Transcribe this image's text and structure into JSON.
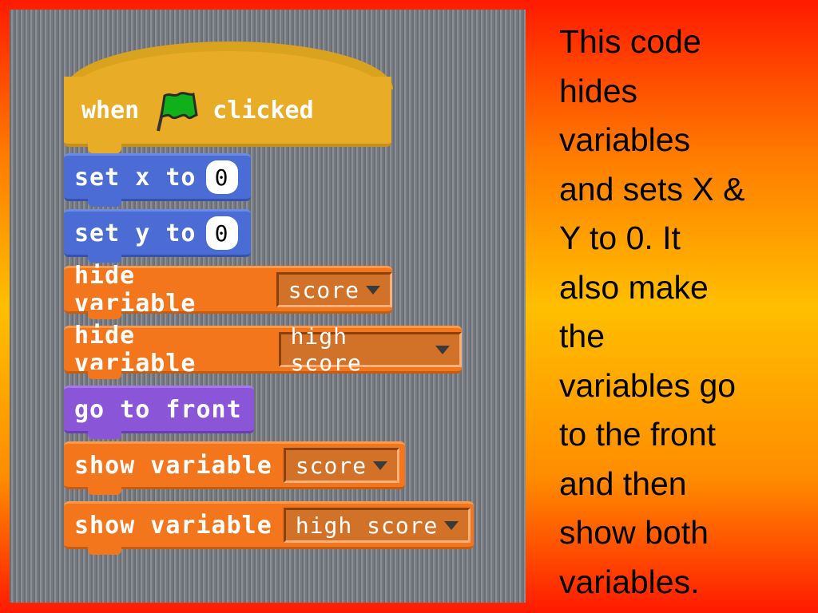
{
  "script": {
    "hat": {
      "before": "when",
      "flag_icon": "green-flag-icon",
      "after": "clicked"
    },
    "blocks": [
      {
        "category": "motion",
        "label": "set x to",
        "input": "0"
      },
      {
        "category": "motion",
        "label": "set y to",
        "input": "0"
      },
      {
        "category": "variables",
        "label": "hide variable",
        "dropdown": "score"
      },
      {
        "category": "variables",
        "label": "hide variable",
        "dropdown": "high score"
      },
      {
        "category": "looks",
        "label": "go to front"
      },
      {
        "category": "variables",
        "label": "show variable",
        "dropdown": "score"
      },
      {
        "category": "variables",
        "label": "show variable",
        "dropdown": "high score"
      }
    ]
  },
  "description": {
    "lines": [
      "This code",
      "hides",
      "variables",
      "and sets X &",
      "Y to 0. It",
      "also make",
      "the",
      "variables go",
      "to the front",
      "and then",
      "show both",
      "variables."
    ]
  },
  "colors": {
    "motion": "#4a6cd4",
    "variables": "#f3761d",
    "looks": "#8a55d7",
    "events": "#e8ac27"
  }
}
